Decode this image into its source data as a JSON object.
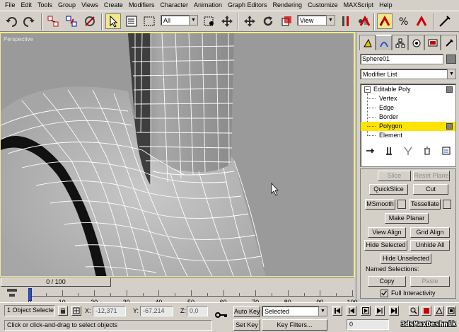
{
  "menu": [
    "File",
    "Edit",
    "Tools",
    "Group",
    "Views",
    "Create",
    "Modifiers",
    "Character",
    "Animation",
    "Graph Editors",
    "Rendering",
    "Customize",
    "MAXScript",
    "Help"
  ],
  "toolbar": {
    "selection_filter": "All",
    "ref_coord": "View",
    "icons": [
      "undo-icon",
      "redo-icon",
      "select-link-icon",
      "unlink-icon",
      "bind-spacewarp-icon",
      "select-object-icon",
      "select-by-name-icon",
      "rect-selection-icon",
      "select-move-icon",
      "select-rotate-icon",
      "select-scale-icon",
      "pivot-icon",
      "snap-icon",
      "angle-snap-icon",
      "percent-snap-icon",
      "spinner-snap-icon"
    ]
  },
  "viewport": {
    "label": "Perspective"
  },
  "command_panel": {
    "object_name": "Sphere01",
    "modifier_list": "Modifier List",
    "stack": {
      "root": "Editable Poly",
      "items": [
        "Vertex",
        "Edge",
        "Border",
        "Polygon",
        "Element"
      ],
      "selected": "Polygon"
    },
    "rollout": {
      "slice": "Slice",
      "reset_plane": "Reset Plane",
      "quickslice": "QuickSlice",
      "cut": "Cut",
      "msmooth": "MSmooth",
      "tessellate": "Tessellate",
      "make_planar": "Make Planar",
      "view_align": "View Align",
      "grid_align": "Grid Align",
      "hide_selected": "Hide Selected",
      "unhide_all": "Unhide All",
      "hide_unselected": "Hide Unselected",
      "named_selections": "Named Selections:",
      "copy": "Copy",
      "paste": "Paste",
      "full_interactivity": "Full Interactivity",
      "full_interactivity_checked": true
    }
  },
  "time": {
    "slider_label": "0 / 100",
    "ticks": [
      "0",
      "10",
      "20",
      "30",
      "40",
      "50",
      "60",
      "70",
      "80",
      "90",
      "100"
    ]
  },
  "status": {
    "selection": "1 Object Selecte",
    "x_label": "X:",
    "x_value": "-12,371",
    "y_label": "Y:",
    "y_value": "-67,214",
    "z_label": "Z:",
    "z_value": "0,0",
    "prompt": "Click or click-and-drag to select objects",
    "auto_key": "Auto Key",
    "set_key": "Set Key",
    "key_mode": "Selected",
    "key_filters": "Key Filters...",
    "frame": "0"
  },
  "watermark": "3dsMaxDeshnik",
  "colors": {
    "accent": "#fce400",
    "viewport_bg": "#9a9a9a",
    "ui_bg": "#d4d0c8"
  }
}
